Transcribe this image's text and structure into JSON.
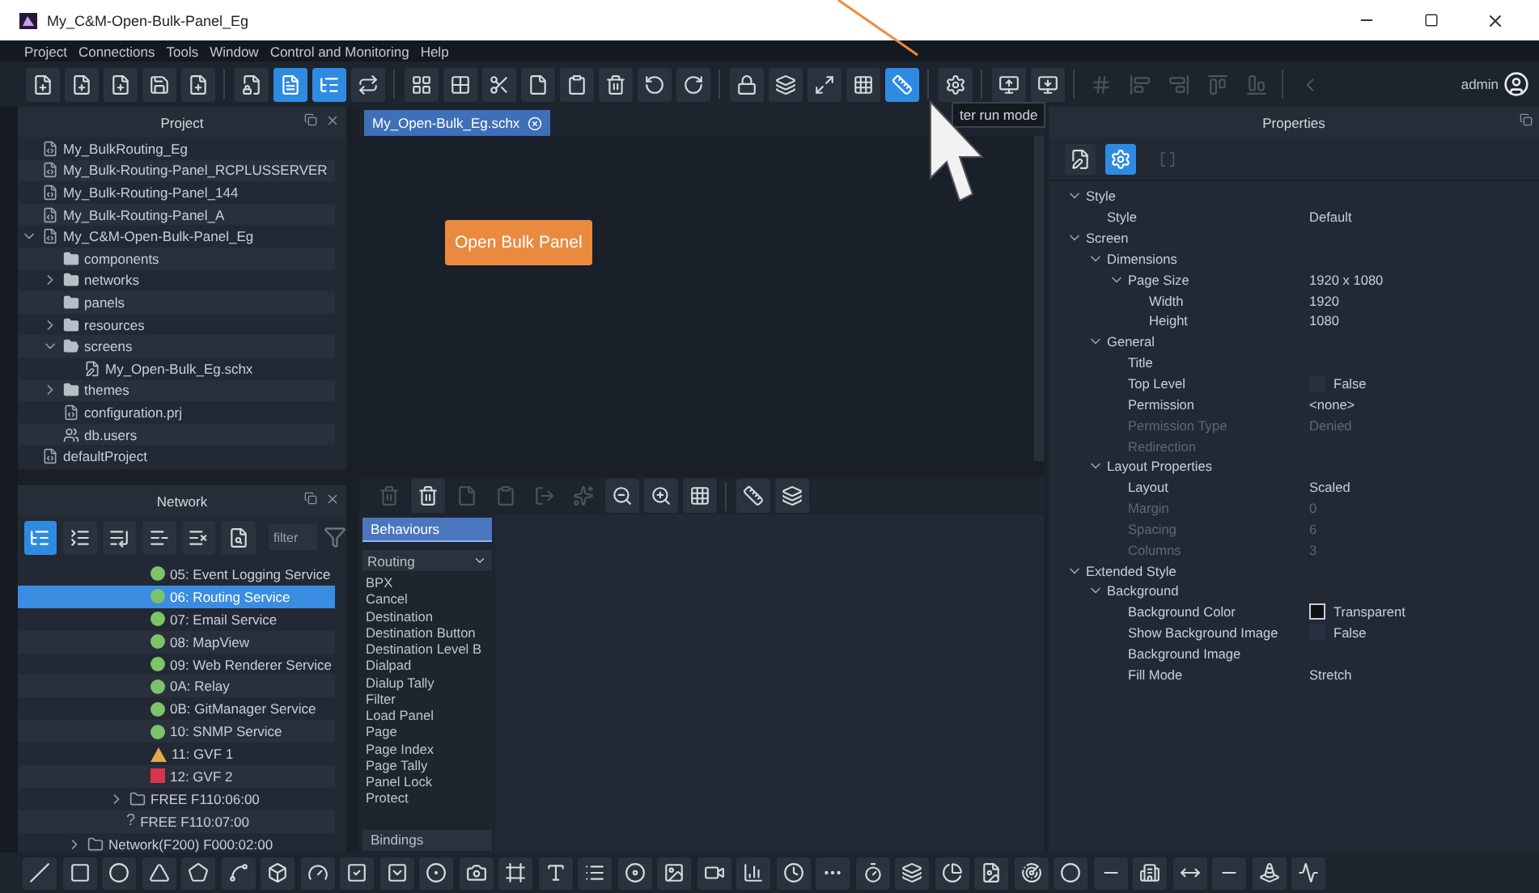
{
  "window": {
    "title": "My_C&M-Open-Bulk-Panel_Eg"
  },
  "menu": [
    "Project",
    "Connections",
    "Tools",
    "Window",
    "Control and Monitoring",
    "Help"
  ],
  "toolbar": [
    {
      "active": false,
      "disabled": false
    },
    {
      "active": false,
      "disabled": false
    },
    {
      "active": false,
      "disabled": false
    },
    {
      "active": false,
      "disabled": false
    },
    {
      "active": false,
      "disabled": false
    },
    {
      "active": false,
      "disabled": false
    },
    {
      "active": true,
      "disabled": false
    },
    {
      "active": true,
      "disabled": false
    },
    {
      "active": false,
      "disabled": false
    },
    {
      "active": false,
      "disabled": false
    },
    {
      "active": false,
      "disabled": false
    },
    {
      "active": false,
      "disabled": false
    },
    {
      "active": false,
      "disabled": false
    },
    {
      "active": false,
      "disabled": false
    },
    {
      "active": false,
      "disabled": false
    },
    {
      "active": false,
      "disabled": false
    },
    {
      "active": false,
      "disabled": false
    },
    {
      "active": false,
      "disabled": false
    },
    {
      "active": false,
      "disabled": false
    },
    {
      "active": false,
      "disabled": false
    },
    {
      "active": false,
      "disabled": false
    },
    {
      "active": true,
      "disabled": false
    },
    {
      "active": false,
      "disabled": false
    },
    {
      "active": false,
      "disabled": false
    },
    {
      "active": false,
      "disabled": false
    },
    {
      "active": false,
      "disabled": true
    },
    {
      "active": false,
      "disabled": true
    },
    {
      "active": false,
      "disabled": true
    },
    {
      "active": false,
      "disabled": true
    },
    {
      "active": false,
      "disabled": true
    },
    {
      "active": false,
      "disabled": true
    }
  ],
  "user": {
    "name": "admin"
  },
  "tooltip": "ter run mode",
  "project_panel": {
    "title": "Project",
    "tree": [
      {
        "label": "My_BulkRouting_Eg",
        "kind": "project"
      },
      {
        "label": "My_Bulk-Routing-Panel_RCPLUSSERVER",
        "kind": "project"
      },
      {
        "label": "My_Bulk-Routing-Panel_144",
        "kind": "project"
      },
      {
        "label": "My_Bulk-Routing-Panel_A",
        "kind": "project"
      },
      {
        "label": "My_C&M-Open-Bulk-Panel_Eg",
        "kind": "project",
        "expanded": true,
        "children": [
          {
            "label": "components",
            "kind": "folder"
          },
          {
            "label": "networks",
            "kind": "folder",
            "expanded": false
          },
          {
            "label": "panels",
            "kind": "folder"
          },
          {
            "label": "resources",
            "kind": "folder",
            "expanded": false
          },
          {
            "label": "screens",
            "kind": "folder",
            "expanded": true,
            "children": [
              {
                "label": "My_Open-Bulk_Eg.schx",
                "kind": "file"
              }
            ]
          },
          {
            "label": "themes",
            "kind": "folder",
            "expanded": false
          },
          {
            "label": "configuration.prj",
            "kind": "project"
          },
          {
            "label": "db.users",
            "kind": "users"
          }
        ]
      },
      {
        "label": "defaultProject",
        "kind": "project"
      }
    ]
  },
  "network_panel": {
    "title": "Network",
    "toolbar": [
      {
        "selected": true
      },
      {
        "selected": false
      },
      {
        "selected": false
      },
      {
        "selected": false
      },
      {
        "selected": false
      },
      {
        "selected": false
      }
    ],
    "filter": {
      "placeholder": "filter"
    },
    "tree": [
      {
        "label": "05: Event Logging Service",
        "kind": "service",
        "color": "#7cc36a",
        "selected": false
      },
      {
        "label": "06: Routing Service",
        "kind": "service",
        "color": "#7cc36a",
        "selected": true
      },
      {
        "label": "07: Email Service",
        "kind": "service",
        "color": "#7cc36a",
        "selected": false
      },
      {
        "label": "08: MapView",
        "kind": "service",
        "color": "#7cc36a",
        "selected": false
      },
      {
        "label": "09: Web Renderer Service",
        "kind": "service",
        "color": "#7cc36a",
        "selected": false
      },
      {
        "label": "0A: Relay",
        "kind": "service",
        "color": "#7cc36a",
        "selected": false
      },
      {
        "label": "0B: GitManager Service",
        "kind": "service",
        "color": "#7cc36a",
        "selected": false
      },
      {
        "label": "10: SNMP Service",
        "kind": "service",
        "color": "#7cc36a",
        "selected": false
      },
      {
        "label": "11: GVF 1",
        "kind": "alert",
        "color": "#e0a94a",
        "selected": false
      },
      {
        "label": "12: GVF 2",
        "kind": "fault",
        "color": "#d9344a",
        "selected": false
      },
      {
        "label": "FREE F110:06:00",
        "kind": "folder",
        "expanded": false,
        "selected": false
      },
      {
        "label": "FREE F110:07:00",
        "kind": "unknown",
        "marker": "?",
        "selected": false
      },
      {
        "label": "Network(F200) F000:02:00",
        "kind": "network",
        "expanded": false,
        "selected": false
      }
    ]
  },
  "editor": {
    "tabs": [
      {
        "label": "My_Open-Bulk_Eg.schx",
        "selected": true
      }
    ],
    "canvas_button": "Open Bulk Panel",
    "toolbar": [
      {
        "disabled": true
      },
      {
        "disabled": false
      },
      {
        "disabled": true
      },
      {
        "disabled": true
      },
      {
        "disabled": true
      },
      {
        "disabled": true
      },
      {
        "disabled": false
      },
      {
        "disabled": false
      },
      {
        "disabled": false
      },
      {
        "disabled": false
      },
      {
        "disabled": false
      }
    ],
    "palette": {
      "sections": [
        {
          "label": "Behaviours",
          "selected": true
        },
        {
          "label": "Bindings",
          "selected": false
        }
      ],
      "category": "Routing",
      "items": [
        "BPX",
        "Cancel",
        "Destination",
        "Destination Button",
        "Destination Level B",
        "Dialpad",
        "Dialup Tally",
        "Filter",
        "Load Panel",
        "Page",
        "Page Index",
        "Page Tally",
        "Panel Lock",
        "Protect"
      ]
    }
  },
  "properties": {
    "title": "Properties",
    "toolbar": [
      {
        "selected": false
      },
      {
        "selected": true
      }
    ],
    "tree": [
      {
        "label": "Style",
        "expanded": true,
        "children": [
          {
            "label": "Style",
            "value": "Default"
          }
        ]
      },
      {
        "label": "Screen",
        "expanded": true,
        "children": [
          {
            "label": "Dimensions",
            "expanded": true,
            "children": [
              {
                "label": "Page Size",
                "value": "1920 x 1080",
                "expanded": true,
                "children": [
                  {
                    "label": "Width",
                    "value": "1920"
                  },
                  {
                    "label": "Height",
                    "value": "1080"
                  }
                ]
              }
            ]
          },
          {
            "label": "General",
            "expanded": true,
            "children": [
              {
                "label": "Title"
              },
              {
                "label": "Top Level",
                "kind": "checkbox",
                "checked": false,
                "value": "False"
              },
              {
                "label": "Permission",
                "value": "<none>"
              },
              {
                "label": "Permission Type",
                "value": "Denied",
                "disabled": true
              },
              {
                "label": "Redirection",
                "disabled": true
              }
            ]
          },
          {
            "label": "Layout Properties",
            "expanded": true,
            "children": [
              {
                "label": "Layout",
                "value": "Scaled"
              },
              {
                "label": "Margin",
                "value": "0",
                "disabled": true
              },
              {
                "label": "Spacing",
                "value": "6",
                "disabled": true
              },
              {
                "label": "Columns",
                "value": "3",
                "disabled": true
              }
            ]
          }
        ]
      },
      {
        "label": "Extended Style",
        "expanded": true,
        "children": [
          {
            "label": "Background",
            "expanded": true,
            "children": [
              {
                "label": "Background Color",
                "kind": "color",
                "value": "Transparent"
              },
              {
                "label": "Show Background Image",
                "kind": "checkbox",
                "checked": false,
                "value": "False"
              },
              {
                "label": "Background Image"
              },
              {
                "label": "Fill Mode",
                "value": "Stretch"
              }
            ]
          }
        ]
      }
    ]
  }
}
